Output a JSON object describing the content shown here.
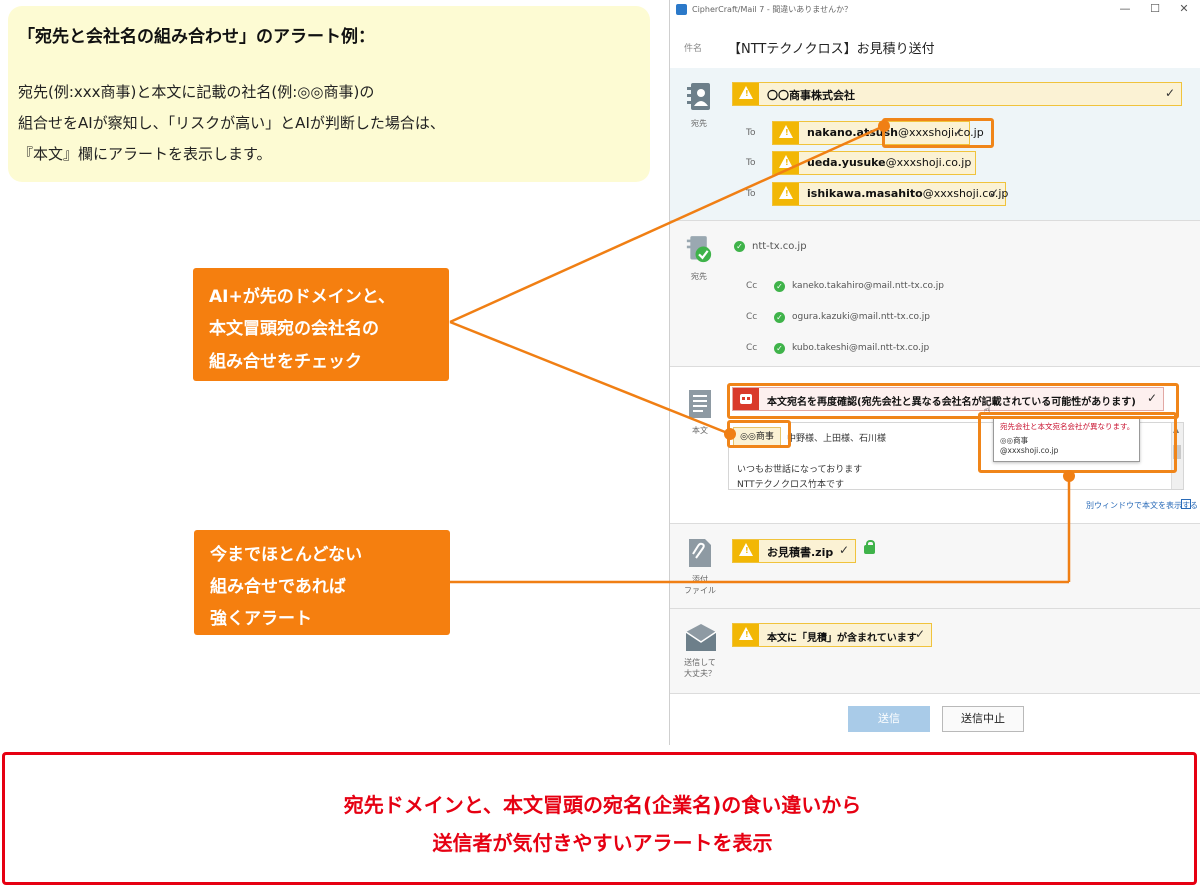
{
  "note": {
    "title": "「宛先と会社名の組み合わせ」のアラート例：",
    "lines": [
      "宛先(例:xxx商事)と本文に記載の社名(例:◎◎商事)の",
      "組合せをAIが察知し、「リスクが高い」とAIが判断した場合は、",
      "『本文』欄にアラートを表示します。"
    ]
  },
  "window": {
    "title": "CipherCraft/Mail 7 - 間違いありませんか？",
    "controls": [
      "—",
      "☐",
      "✕"
    ],
    "subject_label": "件名",
    "subject": "【NTTテクノクロス】お見積り送付"
  },
  "to_section": {
    "side_label": "宛先",
    "company": "〇〇商事株式会社",
    "recipients": [
      {
        "label": "To",
        "name": "nakano.atsush",
        "domain": "@xxxshoji.co.jp"
      },
      {
        "label": "To",
        "name": "ueda.yusuke",
        "domain": "@xxxshoji.co.jp"
      },
      {
        "label": "To",
        "name": "ishikawa.masahito",
        "domain": "@xxxshoji.co.jp"
      }
    ]
  },
  "cc_section": {
    "side_label": "宛先",
    "domain": "ntt-tx.co.jp",
    "recipients": [
      {
        "label": "Cc",
        "address": "kaneko.takahiro@mail.ntt-tx.co.jp"
      },
      {
        "label": "Cc",
        "address": "ogura.kazuki@mail.ntt-tx.co.jp"
      },
      {
        "label": "Cc",
        "address": "kubo.takeshi@mail.ntt-tx.co.jp"
      }
    ]
  },
  "body_section": {
    "side_label": "本文",
    "alert": "本文宛名を再度確認(宛先会社と異なる会社名が記載されている可能性があります)",
    "company_tag": "◎◎商事",
    "first_line_rest": "中野様、上田様、石川様",
    "lines": [
      "いつもお世話になっております",
      "NTTテクノクロス竹本です"
    ],
    "popup_title": "宛先会社と本文宛名会社が異なります。",
    "popup_company": "◎◎商事",
    "popup_domain": "@xxxshoji.co.jp",
    "open_window_link": "別ウィンドウで本文を表示する"
  },
  "attachment_section": {
    "side_label_1": "添付",
    "side_label_2": "ファイル",
    "file": "お見積書.zip"
  },
  "confirm_section": {
    "side_label_1": "送信して",
    "side_label_2": "大丈夫？",
    "alert": "本文に「見積」が含まれています"
  },
  "buttons": {
    "send": "送信",
    "cancel": "送信中止"
  },
  "callouts": {
    "ai_check": [
      "AI+が先のドメインと、",
      "本文冒頭宛の会社名の",
      "組み合せをチェック"
    ],
    "strong_alert": [
      "今までほとんどない",
      "組み合せであれば",
      "強くアラート"
    ]
  },
  "footer": {
    "line1": "宛先ドメインと、本文冒頭の宛名(企業名)の食い違いから",
    "line2": "送信者が気付きやすいアラートを表示"
  },
  "colors": {
    "accent": "#f57f0f",
    "warning": "#f2b705",
    "alert_red": "#e60012",
    "ok_green": "#3fb34a"
  }
}
